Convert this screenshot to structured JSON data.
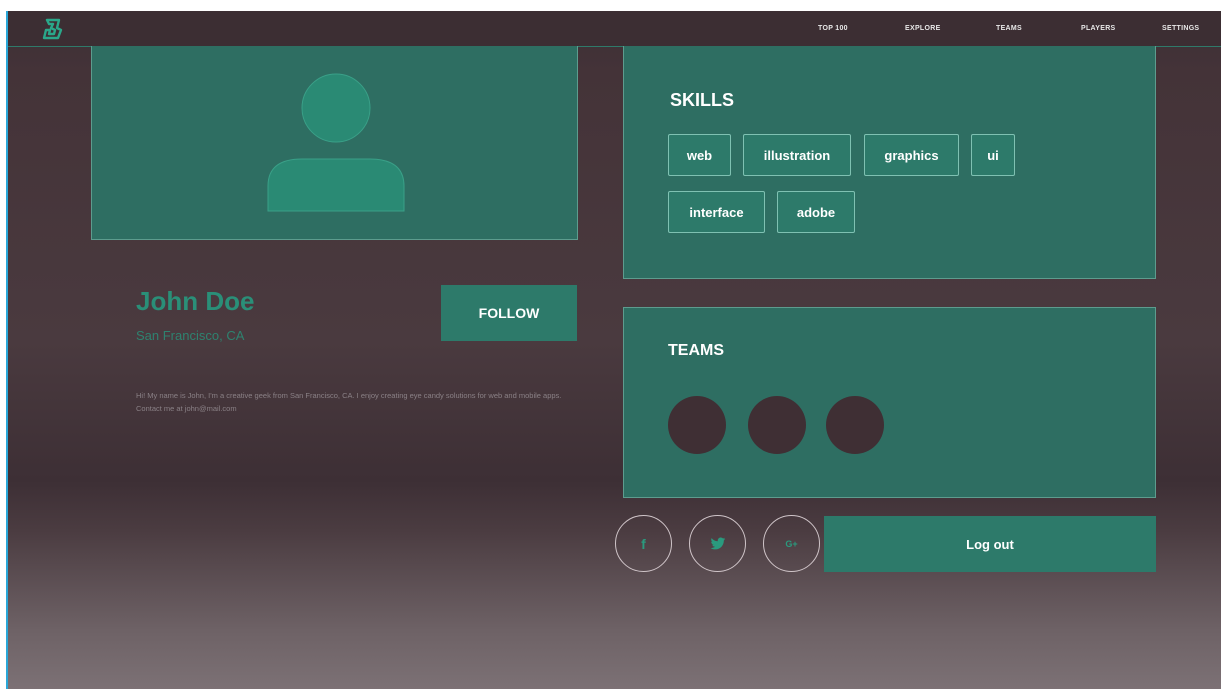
{
  "nav": {
    "logo_icon": "brand-logo",
    "items": [
      "TOP 100",
      "EXPLORE",
      "TEAMS",
      "PLAYERS",
      "SETTINGS"
    ]
  },
  "profile": {
    "name": "John Doe",
    "location": "San Francisco, CA",
    "bio": "Hi! My name is John, I'm a creative geek from San Francisco, CA. I enjoy creating eye candy solutions for web and mobile apps. Contact me at john@mail.com",
    "follow_label": "FOLLOW"
  },
  "skills": {
    "title": "SKILLS",
    "tags": [
      "web",
      "illustration",
      "graphics",
      "ui",
      "interface",
      "adobe"
    ]
  },
  "teams": {
    "title": "TEAMS"
  },
  "social": {
    "facebook_glyph": "f",
    "twitter_icon": "twitter-icon",
    "google_glyph": "G+"
  },
  "logout_label": "Log out",
  "colors": {
    "accent": "#2d7a6a",
    "panel": "#2e6e62",
    "background": "#44353a",
    "name_text": "#2a8f78"
  }
}
